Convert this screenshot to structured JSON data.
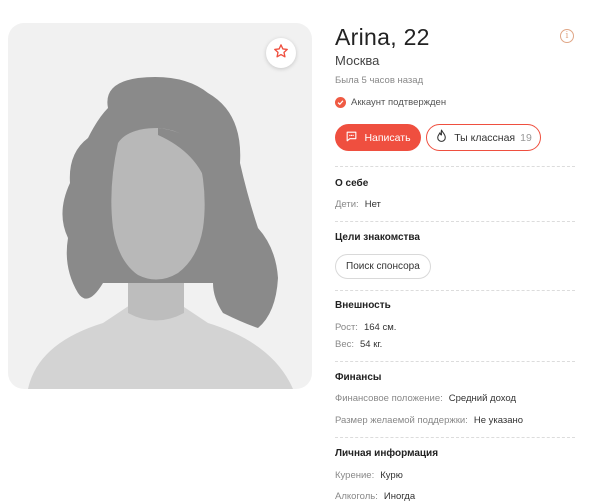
{
  "profile": {
    "name_age": "Arina, 22",
    "city": "Москва",
    "last_seen": "Была 5 часов назад",
    "verified_label": "Аккаунт подтвержден",
    "info_glyph": "i"
  },
  "actions": {
    "write_label": "Написать",
    "like_label": "Ты классная",
    "like_count": "19"
  },
  "icons": {
    "favorite": "star-icon",
    "verified": "check-icon",
    "write": "chat-bubble-icon",
    "like": "flame-icon",
    "info": "info-icon"
  },
  "colors": {
    "accent": "#ef4f3f",
    "photo_bg": "#f1f1f1",
    "hair": "#8a8a8a",
    "face": "#b5b5b5"
  },
  "sections": {
    "about": {
      "title": "О себе",
      "rows": [
        {
          "label": "Дети:",
          "value": "Нет"
        }
      ]
    },
    "goals": {
      "title": "Цели знакомства",
      "chips": [
        "Поиск спонсора"
      ]
    },
    "appearance": {
      "title": "Внешность",
      "rows": [
        {
          "label": "Рост:",
          "value": "164 см."
        },
        {
          "label": "Вес:",
          "value": "54 кг."
        }
      ]
    },
    "finance": {
      "title": "Финансы",
      "rows": [
        {
          "label": "Финансовое положение:",
          "value": "Средний доход"
        },
        {
          "label": "Размер желаемой поддержки:",
          "value": "Не указано"
        }
      ]
    },
    "personal": {
      "title": "Личная информация",
      "rows": [
        {
          "label": "Курение:",
          "value": "Курю"
        },
        {
          "label": "Алкоголь:",
          "value": "Иногда"
        }
      ]
    }
  }
}
